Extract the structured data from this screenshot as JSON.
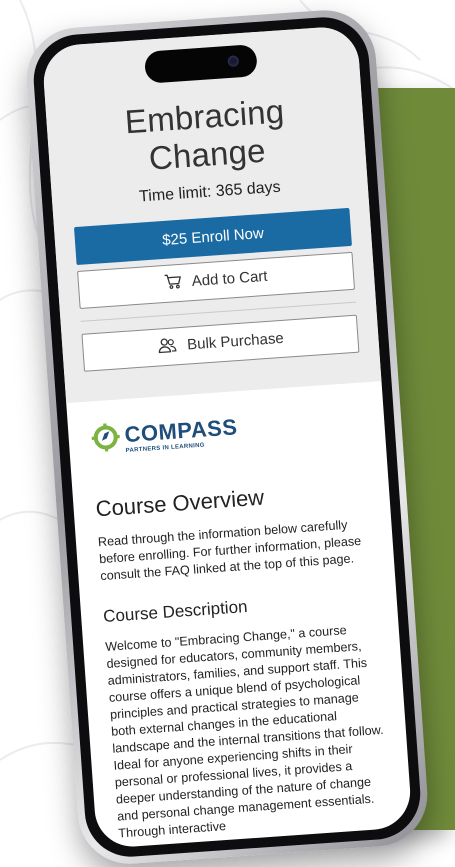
{
  "course": {
    "title": "Embracing Change",
    "time_limit": "Time limit: 365 days"
  },
  "buttons": {
    "enroll": "$25 Enroll Now",
    "add_to_cart": "Add to Cart",
    "bulk_purchase": "Bulk Purchase"
  },
  "logo": {
    "name": "COMPASS",
    "tagline": "PARTNERS IN LEARNING"
  },
  "overview": {
    "heading": "Course Overview",
    "text": "Read through the information below carefully before enrolling. For further information, please consult the FAQ linked at the top of this page."
  },
  "description": {
    "heading": "Course Description",
    "text": "Welcome to \"Embracing Change,\" a course designed for educators, community members, administrators, families, and support staff. This course offers a unique blend of psychological principles and practical strategies to manage both external changes in the educational landscape and the internal transitions that follow. Ideal for anyone experiencing shifts in their personal or professional lives, it provides a deeper understanding of the nature of change and personal change management essentials. Through interactive"
  },
  "colors": {
    "enroll_blue": "#1a6aa3",
    "accent_green": "#6f8b3a",
    "logo_green": "#7cb342",
    "logo_navy": "#1f4e7a"
  },
  "icons": {
    "cart": "cart-icon",
    "bulk": "users-icon",
    "logo": "compass-icon"
  }
}
